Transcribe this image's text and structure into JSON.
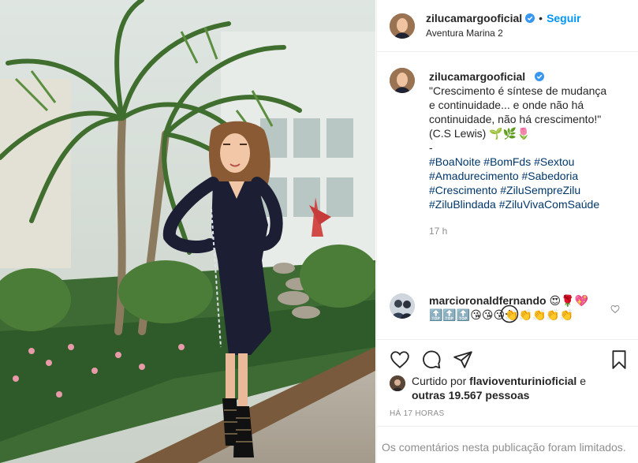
{
  "post": {
    "username": "zilucamargooficial",
    "follow_label": "Seguir",
    "location": "Aventura Marina 2",
    "dot": "•"
  },
  "caption": {
    "username": "zilucamargooficial",
    "text": "\"Crescimento é síntese de mudança e continuidade... e onde não há continuidade, não há crescimento!\" (C.S Lewis) 🌱🌿🌷",
    "dash": "-",
    "hashtags": [
      "#BoaNoite",
      "#BomFds",
      "#Sextou",
      "#Amadurecimento",
      "#Sabedoria",
      "#Crescimento",
      "#ZiluSempreZilu",
      "#ZiluBlindada",
      "#ZiluVivaComSaúde"
    ],
    "time_ago": "17 h"
  },
  "comment": {
    "username": "marcioronaldfernando",
    "text": "😍🌹💖 🔝🔝🔝😘😘😘👏👏👏👏👏"
  },
  "likes": {
    "prefix": "Curtido por",
    "liker": "flavioventurinioficial",
    "and": "e",
    "others": "outras 19.567 pessoas"
  },
  "timestamp": "HÁ 17 HORAS",
  "comments_limited": "Os comentários nesta publicação foram limitados.",
  "icons": {
    "verified": "verified-badge-icon",
    "plus": "plus-circle-icon",
    "heart": "heart-icon",
    "comment": "comment-icon",
    "share": "send-icon",
    "save": "bookmark-icon"
  },
  "colors": {
    "link_blue": "#0095f6",
    "hashtag_blue": "#00376b",
    "muted": "#8e8e8e",
    "text": "#262626"
  }
}
